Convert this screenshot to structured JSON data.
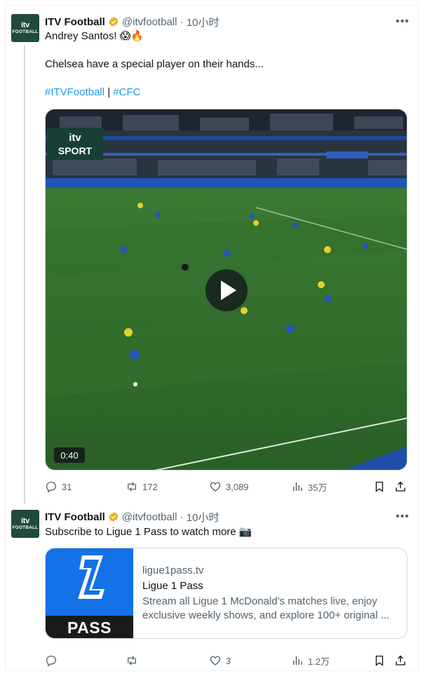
{
  "tweets": [
    {
      "name": "ITV Football",
      "handle": "@itvfootball",
      "time": "10小时",
      "avatar": {
        "line1": "itv",
        "line2": "FOOTBALL"
      },
      "lines": [
        "Andrey Santos! 😱🔥",
        "Chelsea have a special player on their hands..."
      ],
      "hashtags": [
        "#ITVFootball",
        "|",
        "#CFC"
      ],
      "video": {
        "duration": "0:40",
        "overlay_line1": "itv",
        "overlay_line2": "SPORT"
      },
      "stats": {
        "replies": "31",
        "reposts": "172",
        "likes": "3,089",
        "views": "35万"
      }
    },
    {
      "name": "ITV Football",
      "handle": "@itvfootball",
      "time": "10小时",
      "avatar": {
        "line1": "itv",
        "line2": "FOOTBALL"
      },
      "lines": [
        "Subscribe to Ligue 1 Pass to watch more 📷"
      ],
      "card": {
        "domain": "ligue1pass.tv",
        "title": "Ligue 1 Pass",
        "desc_line1": "Stream all Ligue 1 McDonald’s matches live, enjoy",
        "desc_line2": "exclusive weekly shows, and explore 100+ original ...",
        "image_label": "PASS"
      },
      "stats": {
        "replies": "",
        "reposts": "",
        "likes": "3",
        "views": "1.2万"
      }
    }
  ],
  "colors": {
    "accent": "#1d9bf0",
    "muted": "#536471",
    "pitch": "#2f6b2a",
    "avatar_bg": "#1f4a3d",
    "card_blue": "#1471e8"
  }
}
